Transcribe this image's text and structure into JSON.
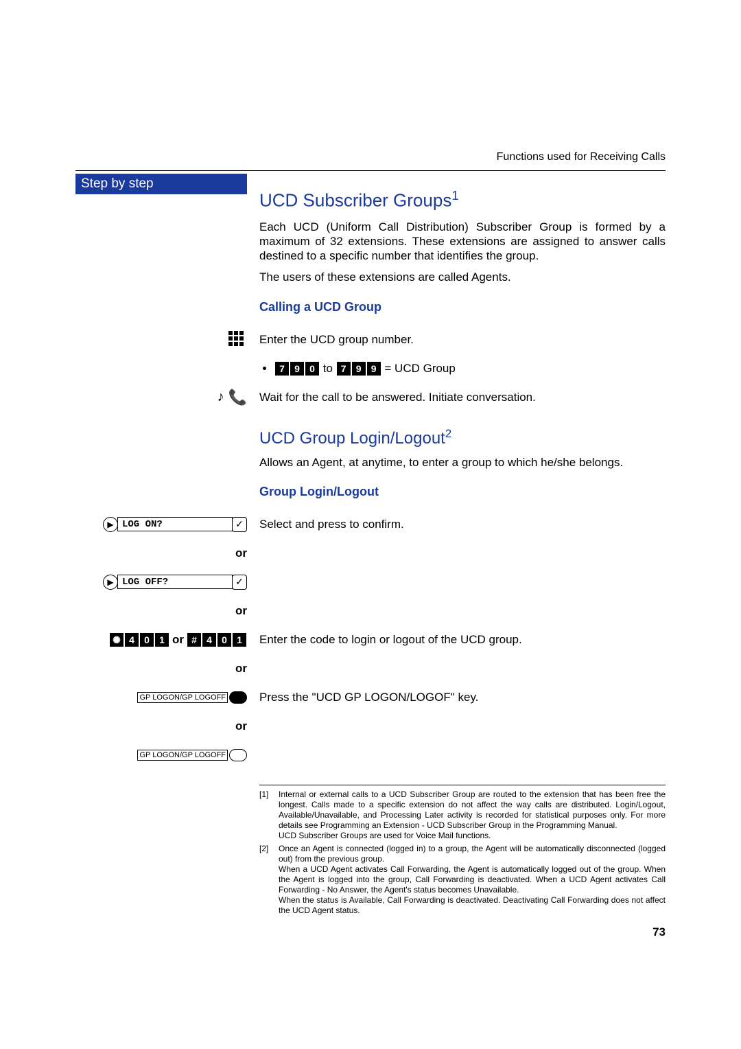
{
  "header": {
    "section": "Functions used for Receiving Calls"
  },
  "sidebar": {
    "title": "Step by step"
  },
  "section1": {
    "title": "UCD Subscriber Groups",
    "para1": "Each UCD (Uniform Call Distribution) Subscriber Group is formed by a maximum of 32 extensions. These extensions are assigned to answer calls destined to a specific number that identifies the group.",
    "para2": "The users of these extensions are called Agents.",
    "sub1": "Calling a UCD Group",
    "enter_group": "Enter the UCD group number.",
    "code_from": [
      "7",
      "9",
      "0"
    ],
    "code_to": [
      "7",
      "9",
      "9"
    ],
    "to_word": "to",
    "code_equals": " = UCD Group",
    "wait_text": "Wait for the call to be answered. Initiate conversation."
  },
  "section2": {
    "title": "UCD Group Login/Logout",
    "intro": "Allows an Agent, at anytime, to enter a group to which he/she belongs.",
    "sub1": "Group Login/Logout",
    "select_confirm": "Select and press to confirm.",
    "opt_login": "LOG ON?",
    "opt_logout": "LOG OFF?",
    "or": "or",
    "code_login": [
      "*",
      "4",
      "0",
      "1"
    ],
    "code_logout": [
      "#",
      "4",
      "0",
      "1"
    ],
    "code_or": "or",
    "enter_code_text": "Enter the code to login or logout of the UCD group.",
    "softkey_label": "GP LOGON/GP LOGOFF",
    "press_key_text": "Press the \"UCD GP LOGON/LOGOF\" key."
  },
  "footnotes": {
    "n1": "Internal or external calls to a UCD Subscriber Group are routed to the extension that has been free the longest. Calls made to a specific extension do not affect the way calls are distributed. Login/Logout, Available/Unavailable, and Processing Later activity is recorded for statistical purposes only. For more details see Programming an Extension - UCD Subscriber Group in the Programming Manual.\nUCD Subscriber Groups are used for Voice Mail functions.",
    "n2": "Once an Agent is connected (logged in) to a group, the Agent will be automatically disconnected (logged out) from the previous group.\nWhen a UCD Agent activates Call Forwarding, the Agent is automatically logged out of the group. When the Agent is logged into the group, Call Forwarding is deactivated. When a UCD Agent activates Call Forwarding - No Answer, the Agent's status becomes Unavailable.\nWhen the status is Available, Call Forwarding is deactivated. Deactivating Call Forwarding does not affect the UCD Agent status."
  },
  "page_number": "73"
}
